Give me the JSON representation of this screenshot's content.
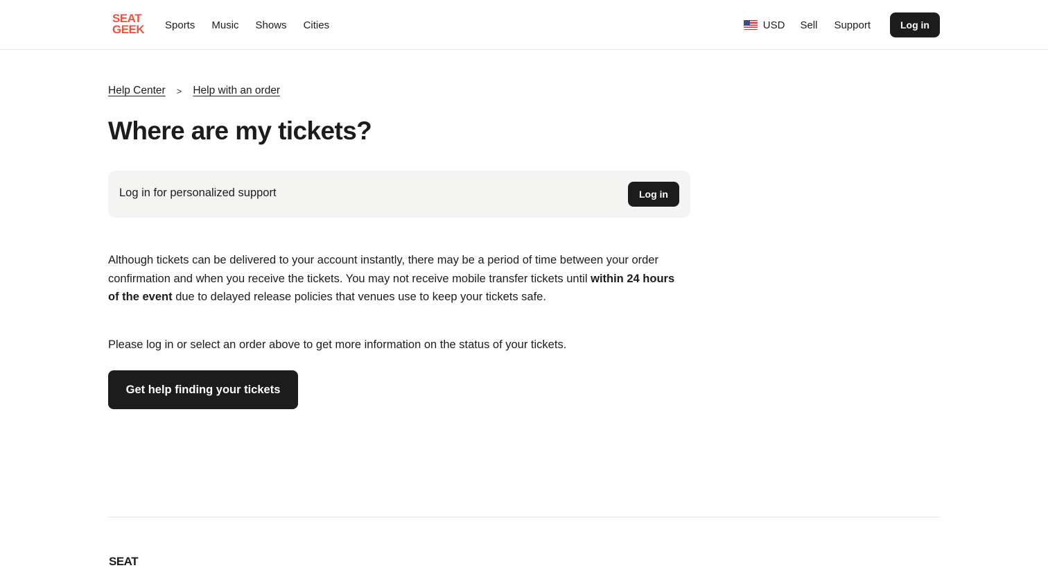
{
  "header": {
    "logo_top": "SEAT",
    "logo_bottom": "GEEK",
    "nav": [
      "Sports",
      "Music",
      "Shows",
      "Cities"
    ],
    "currency": "USD",
    "sell": "Sell",
    "support": "Support",
    "login": "Log in"
  },
  "breadcrumb": {
    "home": "Help Center",
    "separator": ">",
    "current": "Help with an order"
  },
  "page": {
    "title": "Where are my tickets?"
  },
  "login_card": {
    "text": "Log in for personalized support",
    "button": "Log in"
  },
  "content": {
    "para1_a": "Although tickets can be delivered to your account instantly, there may be a period of time between your order confirmation and when you receive the tickets. You may not receive mobile transfer tickets until ",
    "para1_bold": "within 24 hours of the event",
    "para1_b": " due to delayed release policies that venues use to keep your tickets safe.",
    "para2": "Please log in or select an order above to get more information on the status of your tickets.",
    "help_button": "Get help finding your tickets"
  },
  "footer": {
    "logo_top": "SEAT"
  },
  "colors": {
    "brand": "#f0523f",
    "dark_button": "#1c1c1c",
    "card_bg": "#f4f4f2"
  },
  "icons": {
    "flag": "us-flag-icon",
    "separator": "chevron-right-icon"
  }
}
